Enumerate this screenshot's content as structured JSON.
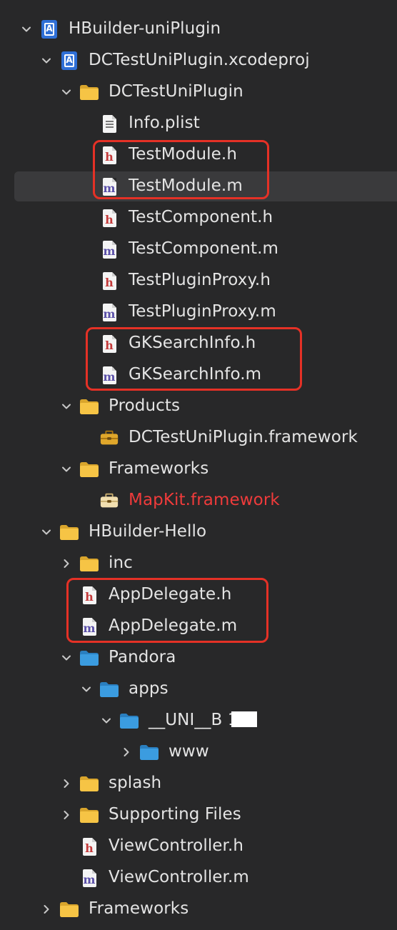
{
  "colors": {
    "background": "#282829",
    "selection": "#3a3a3c",
    "folder_yellow": "#f6c445",
    "folder_blue": "#3b9ce0",
    "error_red": "#ef3b3b",
    "highlight_box": "#e53126"
  },
  "tree": [
    {
      "label": "HBuilder-uniPlugin",
      "icon": "app-project-icon",
      "expanded": true
    },
    {
      "label": "DCTestUniPlugin.xcodeproj",
      "icon": "xcodeproj-icon",
      "expanded": true
    },
    {
      "label": "DCTestUniPlugin",
      "icon": "folder-icon",
      "expanded": true
    },
    {
      "label": "Info.plist",
      "icon": "plist-file-icon"
    },
    {
      "label": "TestModule.h",
      "icon": "header-file-icon"
    },
    {
      "label": "TestModule.m",
      "icon": "objc-file-icon",
      "selected": true
    },
    {
      "label": "TestComponent.h",
      "icon": "header-file-icon"
    },
    {
      "label": "TestComponent.m",
      "icon": "objc-file-icon"
    },
    {
      "label": "TestPluginProxy.h",
      "icon": "header-file-icon"
    },
    {
      "label": "TestPluginProxy.m",
      "icon": "objc-file-icon"
    },
    {
      "label": "GKSearchInfo.h",
      "icon": "header-file-icon"
    },
    {
      "label": "GKSearchInfo.m",
      "icon": "objc-file-icon"
    },
    {
      "label": "Products",
      "icon": "folder-icon",
      "expanded": true
    },
    {
      "label": "DCTestUniPlugin.framework",
      "icon": "framework-icon"
    },
    {
      "label": "Frameworks",
      "icon": "folder-icon",
      "expanded": true
    },
    {
      "label": "MapKit.framework",
      "icon": "framework-missing-icon",
      "missing": true
    },
    {
      "label": "HBuilder-Hello",
      "icon": "folder-icon",
      "expanded": true
    },
    {
      "label": "inc",
      "icon": "folder-icon",
      "expanded": false
    },
    {
      "label": "AppDelegate.h",
      "icon": "header-file-icon"
    },
    {
      "label": "AppDelegate.m",
      "icon": "objc-file-icon"
    },
    {
      "label": "Pandora",
      "icon": "blue-folder-icon",
      "expanded": true
    },
    {
      "label": "apps",
      "icon": "blue-folder-icon",
      "expanded": true
    },
    {
      "label": "__UNI__B      12",
      "icon": "blue-folder-icon",
      "expanded": true
    },
    {
      "label": "www",
      "icon": "blue-folder-icon",
      "expanded": false
    },
    {
      "label": "splash",
      "icon": "folder-icon",
      "expanded": false
    },
    {
      "label": "Supporting Files",
      "icon": "folder-icon",
      "expanded": false
    },
    {
      "label": "ViewController.h",
      "icon": "header-file-icon"
    },
    {
      "label": "ViewController.m",
      "icon": "objc-file-icon"
    },
    {
      "label": "Frameworks",
      "icon": "folder-icon",
      "expanded": false
    }
  ]
}
